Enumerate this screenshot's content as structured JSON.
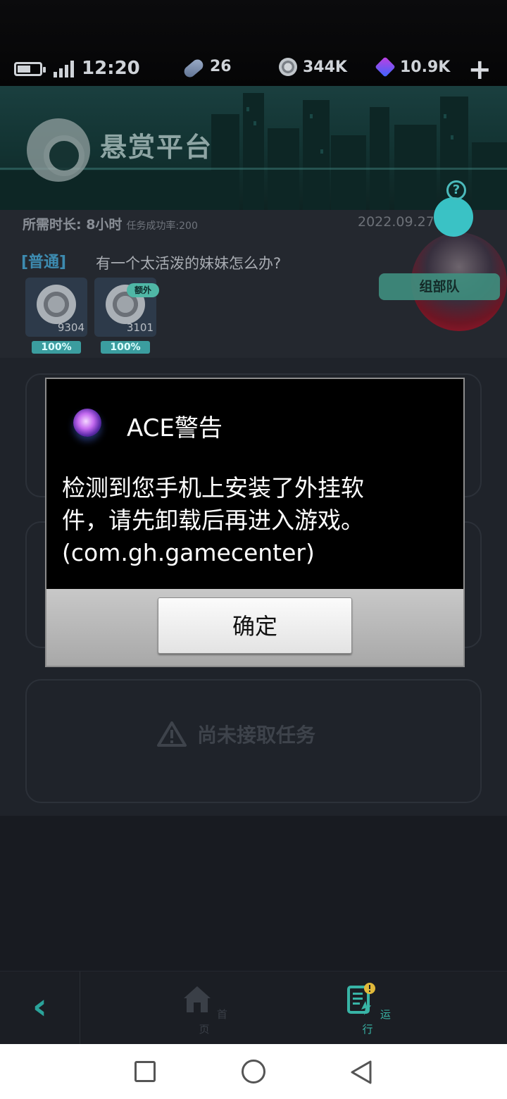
{
  "status_bar": {
    "time": "12:20",
    "resources": [
      {
        "icon": "bandage-icon",
        "value": "26"
      },
      {
        "icon": "coin-icon",
        "value": "344K"
      },
      {
        "icon": "cube-icon",
        "value": "10.9K"
      }
    ],
    "add_label": "+"
  },
  "header": {
    "title": "悬赏平台"
  },
  "task": {
    "duration": "所需时长: 8小时",
    "success_rate": "任务成功率:200",
    "date": "2022.09.27",
    "category": "[普通]",
    "question": "有一个太活泼的妹妹怎么办?",
    "rewards": [
      {
        "amount": "9304",
        "percent": "100%"
      },
      {
        "amount": "3101",
        "percent": "100%",
        "badge": "额外"
      }
    ],
    "team_button": "组部队",
    "help_label": "?"
  },
  "content": {
    "empty_text": "尚未接取任务"
  },
  "bottom_nav": {
    "back_label": "‹",
    "items": [
      {
        "label": "首页",
        "icon": "home-icon"
      },
      {
        "label": "运行",
        "icon": "task-list-icon"
      }
    ]
  },
  "dialog": {
    "title": "ACE警告",
    "message_line1": "检测到您手机上安装了外挂软",
    "message_line2": "件，请先卸载后再进入游戏。",
    "message_line3": "(com.gh.gamecenter)",
    "ok_label": "确定"
  },
  "colors": {
    "accent_teal": "#2aa39a",
    "dialog_bg": "#000000",
    "dialog_footer": "#b8b8b8"
  }
}
